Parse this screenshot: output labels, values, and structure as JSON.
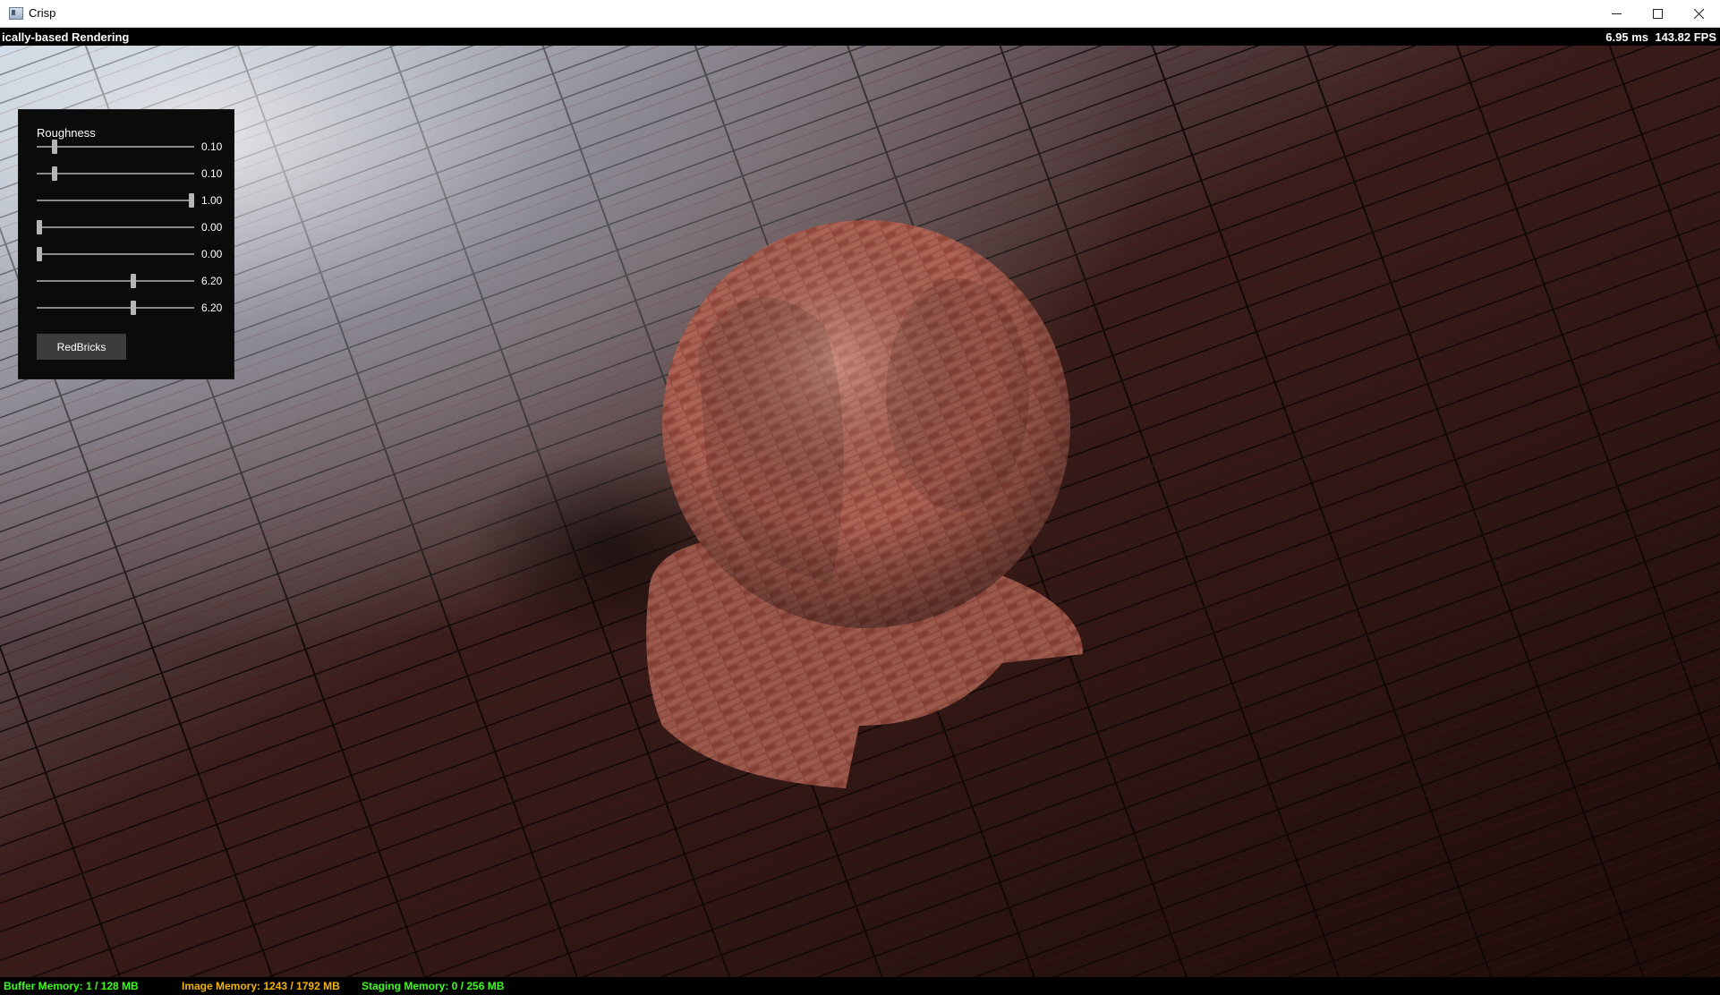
{
  "window": {
    "title": "Crisp"
  },
  "header": {
    "title": "ically-based Rendering",
    "frame_time": "6.95 ms",
    "fps": "143.82 FPS"
  },
  "panel": {
    "title": "Roughness",
    "sliders": [
      {
        "value": "0.10",
        "fraction": 0.1
      },
      {
        "value": "0.10",
        "fraction": 0.1
      },
      {
        "value": "1.00",
        "fraction": 1.0
      },
      {
        "value": "0.00",
        "fraction": 0.0
      },
      {
        "value": "0.00",
        "fraction": 0.0
      },
      {
        "value": "6.20",
        "fraction": 0.62
      },
      {
        "value": "6.20",
        "fraction": 0.62
      }
    ],
    "material_button": "RedBricks"
  },
  "status": {
    "buffer_memory": "Buffer Memory: 1 / 128 MB",
    "image_memory": "Image Memory: 1243 / 1792 MB",
    "staging_memory": "Staging Memory: 0 / 256 MB"
  },
  "colors": {
    "buffer_memory": "#39ff14",
    "image_memory": "#f4b400",
    "staging_memory": "#39ff14"
  }
}
